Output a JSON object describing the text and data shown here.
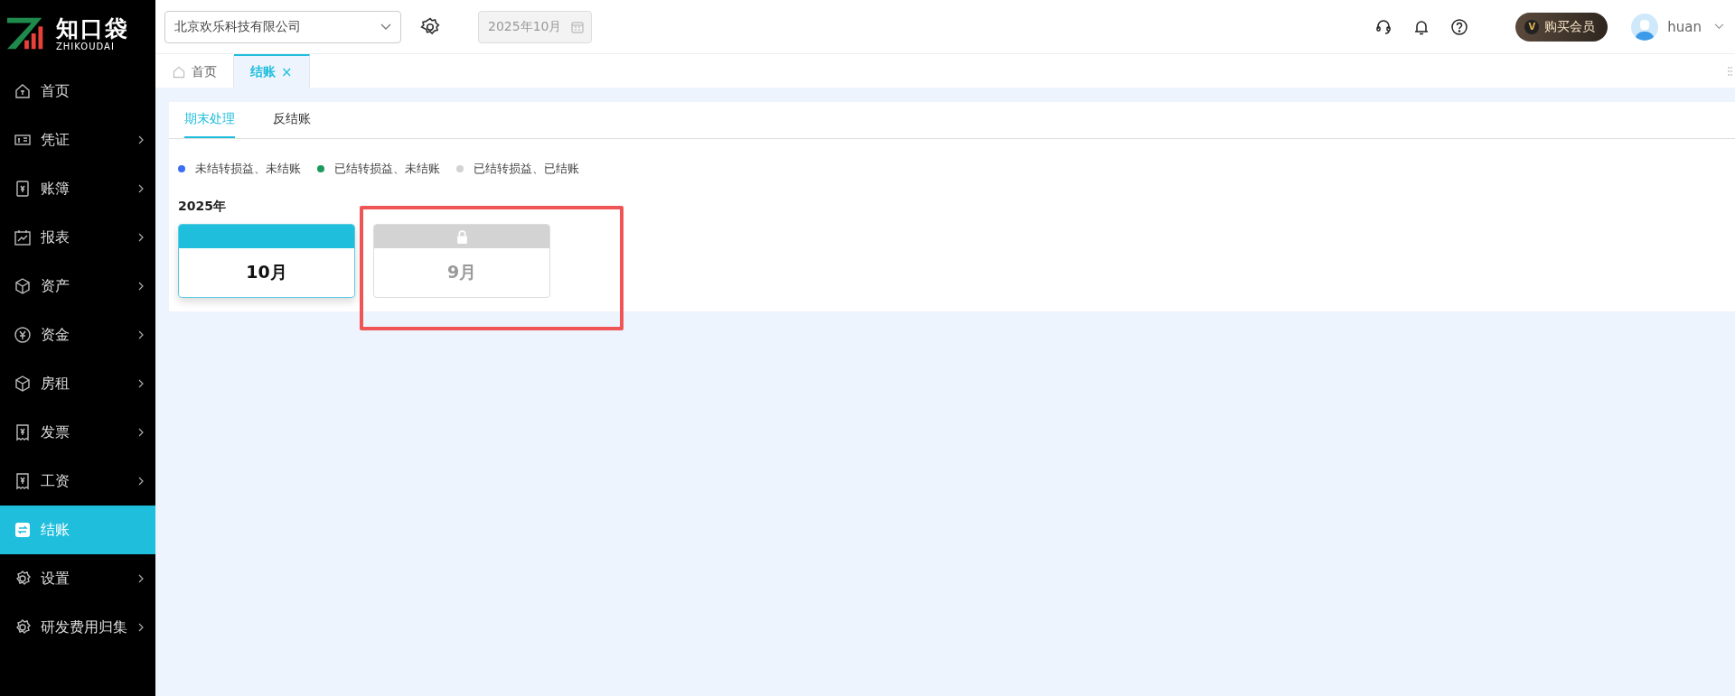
{
  "logo": {
    "name": "知口袋",
    "subtitle": "ZHIKOUDAI"
  },
  "header": {
    "company": "北京欢乐科技有限公司",
    "period": "2025年10月",
    "vip_button": "购买会员",
    "vip_badge": "V",
    "user": "huan"
  },
  "sidebar": {
    "items": [
      {
        "label": "首页",
        "kind": "home",
        "has_children": false,
        "selected": false
      },
      {
        "label": "凭证",
        "kind": "voucher",
        "has_children": true,
        "selected": false
      },
      {
        "label": "账簿",
        "kind": "ledger",
        "has_children": true,
        "selected": false
      },
      {
        "label": "报表",
        "kind": "chart",
        "has_children": true,
        "selected": false
      },
      {
        "label": "资产",
        "kind": "box",
        "has_children": true,
        "selected": false
      },
      {
        "label": "资金",
        "kind": "coin",
        "has_children": true,
        "selected": false
      },
      {
        "label": "房租",
        "kind": "box",
        "has_children": true,
        "selected": false
      },
      {
        "label": "发票",
        "kind": "receipt",
        "has_children": true,
        "selected": false
      },
      {
        "label": "工资",
        "kind": "receipt",
        "has_children": true,
        "selected": false
      },
      {
        "label": "结账",
        "kind": "swap",
        "has_children": false,
        "selected": true
      },
      {
        "label": "设置",
        "kind": "gear",
        "has_children": true,
        "selected": false
      },
      {
        "label": "研发费用归集",
        "kind": "gear",
        "has_children": true,
        "selected": false
      }
    ]
  },
  "page_tabs": [
    {
      "label": "首页",
      "kind": "home",
      "selected": false
    },
    {
      "label": "结账",
      "kind": "closable",
      "close": "×",
      "selected": true
    }
  ],
  "sub_tabs": [
    {
      "label": "期末处理",
      "selected": true
    },
    {
      "label": "反结账",
      "selected": false
    }
  ],
  "legend": [
    {
      "label": "未结转损益、未结账",
      "color": "#3d6ff5"
    },
    {
      "label": "已结转损益、未结账",
      "color": "#1b9a5c"
    },
    {
      "label": "已结转损益、已结账",
      "color": "#d3d3d3"
    }
  ],
  "year": "2025年",
  "periods": [
    {
      "label": "10月",
      "selected": true,
      "locked": false,
      "highlighted": false
    },
    {
      "label": "9月",
      "selected": false,
      "locked": true,
      "highlighted": true
    }
  ]
}
